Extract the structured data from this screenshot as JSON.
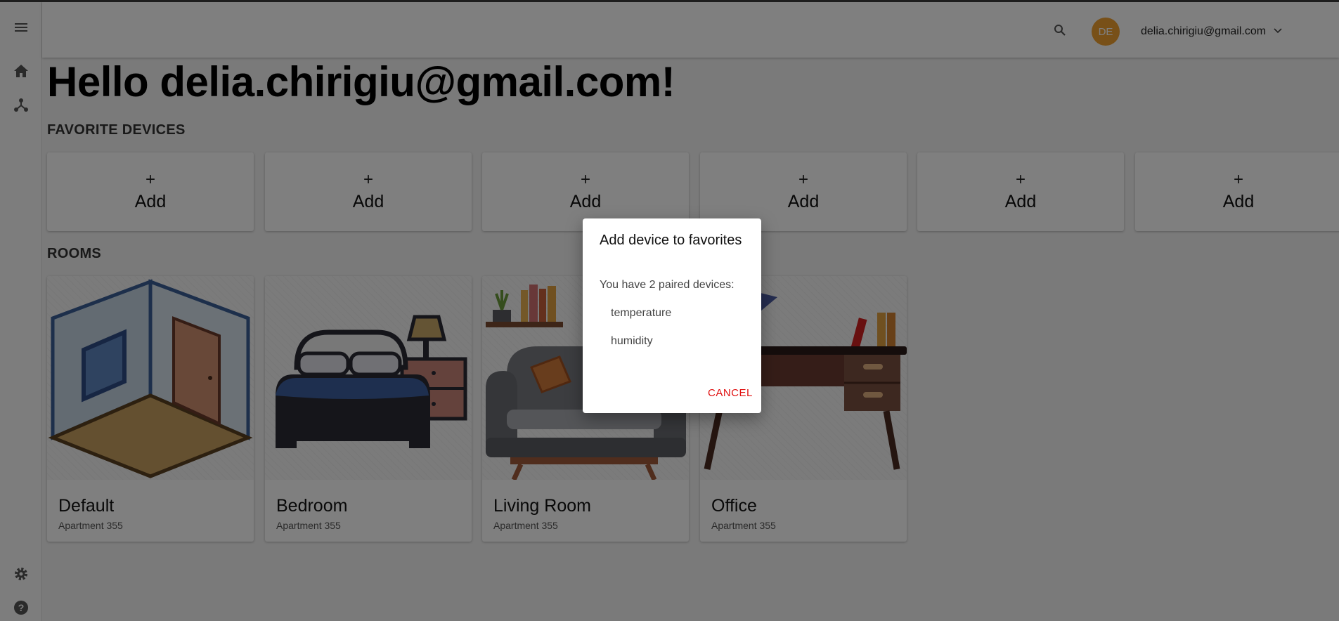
{
  "user": {
    "avatar_initials": "DE",
    "email": "delia.chirigiu@gmail.com"
  },
  "greeting": "Hello delia.chirigiu@gmail.com!",
  "sidebar": {
    "icons": [
      "menu-icon",
      "home-icon",
      "network-icon",
      "settings-icon",
      "help-icon"
    ]
  },
  "favorites": {
    "title": "FAVORITE DEVICES",
    "cards": [
      {
        "plus": "+",
        "label": "Add"
      },
      {
        "plus": "+",
        "label": "Add"
      },
      {
        "plus": "+",
        "label": "Add"
      },
      {
        "plus": "+",
        "label": "Add"
      },
      {
        "plus": "+",
        "label": "Add"
      },
      {
        "plus": "+",
        "label": "Add"
      }
    ]
  },
  "rooms": {
    "title": "ROOMS",
    "items": [
      {
        "name": "Default",
        "subtitle": "Apartment 355"
      },
      {
        "name": "Bedroom",
        "subtitle": "Apartment 355"
      },
      {
        "name": "Living Room",
        "subtitle": "Apartment 355"
      },
      {
        "name": "Office",
        "subtitle": "Apartment 355"
      }
    ]
  },
  "dialog": {
    "title": "Add device to favorites",
    "text": "You have 2 paired devices:",
    "devices": [
      "temperature",
      "humidity"
    ],
    "cancel_label": "CANCEL"
  },
  "colors": {
    "avatar": "#f0a030",
    "cancel": "#e01010"
  }
}
